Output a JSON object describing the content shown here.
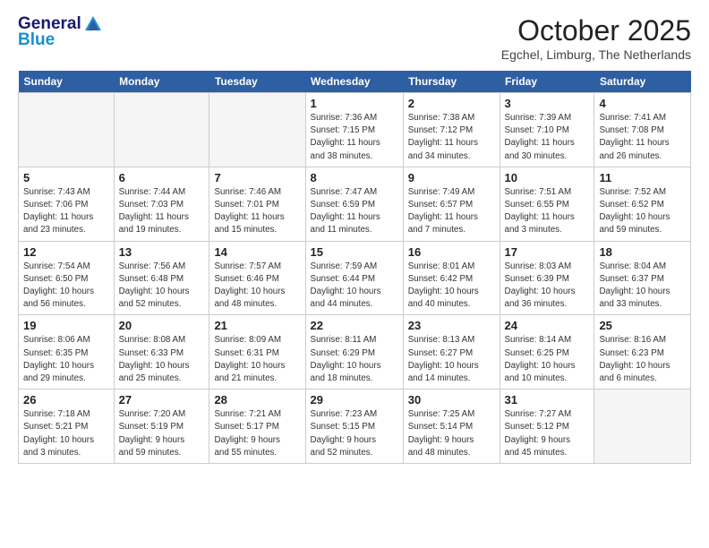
{
  "header": {
    "logo_line1": "General",
    "logo_line2": "Blue",
    "month": "October 2025",
    "location": "Egchel, Limburg, The Netherlands"
  },
  "weekdays": [
    "Sunday",
    "Monday",
    "Tuesday",
    "Wednesday",
    "Thursday",
    "Friday",
    "Saturday"
  ],
  "weeks": [
    [
      {
        "day": "",
        "info": ""
      },
      {
        "day": "",
        "info": ""
      },
      {
        "day": "",
        "info": ""
      },
      {
        "day": "1",
        "info": "Sunrise: 7:36 AM\nSunset: 7:15 PM\nDaylight: 11 hours\nand 38 minutes."
      },
      {
        "day": "2",
        "info": "Sunrise: 7:38 AM\nSunset: 7:12 PM\nDaylight: 11 hours\nand 34 minutes."
      },
      {
        "day": "3",
        "info": "Sunrise: 7:39 AM\nSunset: 7:10 PM\nDaylight: 11 hours\nand 30 minutes."
      },
      {
        "day": "4",
        "info": "Sunrise: 7:41 AM\nSunset: 7:08 PM\nDaylight: 11 hours\nand 26 minutes."
      }
    ],
    [
      {
        "day": "5",
        "info": "Sunrise: 7:43 AM\nSunset: 7:06 PM\nDaylight: 11 hours\nand 23 minutes."
      },
      {
        "day": "6",
        "info": "Sunrise: 7:44 AM\nSunset: 7:03 PM\nDaylight: 11 hours\nand 19 minutes."
      },
      {
        "day": "7",
        "info": "Sunrise: 7:46 AM\nSunset: 7:01 PM\nDaylight: 11 hours\nand 15 minutes."
      },
      {
        "day": "8",
        "info": "Sunrise: 7:47 AM\nSunset: 6:59 PM\nDaylight: 11 hours\nand 11 minutes."
      },
      {
        "day": "9",
        "info": "Sunrise: 7:49 AM\nSunset: 6:57 PM\nDaylight: 11 hours\nand 7 minutes."
      },
      {
        "day": "10",
        "info": "Sunrise: 7:51 AM\nSunset: 6:55 PM\nDaylight: 11 hours\nand 3 minutes."
      },
      {
        "day": "11",
        "info": "Sunrise: 7:52 AM\nSunset: 6:52 PM\nDaylight: 10 hours\nand 59 minutes."
      }
    ],
    [
      {
        "day": "12",
        "info": "Sunrise: 7:54 AM\nSunset: 6:50 PM\nDaylight: 10 hours\nand 56 minutes."
      },
      {
        "day": "13",
        "info": "Sunrise: 7:56 AM\nSunset: 6:48 PM\nDaylight: 10 hours\nand 52 minutes."
      },
      {
        "day": "14",
        "info": "Sunrise: 7:57 AM\nSunset: 6:46 PM\nDaylight: 10 hours\nand 48 minutes."
      },
      {
        "day": "15",
        "info": "Sunrise: 7:59 AM\nSunset: 6:44 PM\nDaylight: 10 hours\nand 44 minutes."
      },
      {
        "day": "16",
        "info": "Sunrise: 8:01 AM\nSunset: 6:42 PM\nDaylight: 10 hours\nand 40 minutes."
      },
      {
        "day": "17",
        "info": "Sunrise: 8:03 AM\nSunset: 6:39 PM\nDaylight: 10 hours\nand 36 minutes."
      },
      {
        "day": "18",
        "info": "Sunrise: 8:04 AM\nSunset: 6:37 PM\nDaylight: 10 hours\nand 33 minutes."
      }
    ],
    [
      {
        "day": "19",
        "info": "Sunrise: 8:06 AM\nSunset: 6:35 PM\nDaylight: 10 hours\nand 29 minutes."
      },
      {
        "day": "20",
        "info": "Sunrise: 8:08 AM\nSunset: 6:33 PM\nDaylight: 10 hours\nand 25 minutes."
      },
      {
        "day": "21",
        "info": "Sunrise: 8:09 AM\nSunset: 6:31 PM\nDaylight: 10 hours\nand 21 minutes."
      },
      {
        "day": "22",
        "info": "Sunrise: 8:11 AM\nSunset: 6:29 PM\nDaylight: 10 hours\nand 18 minutes."
      },
      {
        "day": "23",
        "info": "Sunrise: 8:13 AM\nSunset: 6:27 PM\nDaylight: 10 hours\nand 14 minutes."
      },
      {
        "day": "24",
        "info": "Sunrise: 8:14 AM\nSunset: 6:25 PM\nDaylight: 10 hours\nand 10 minutes."
      },
      {
        "day": "25",
        "info": "Sunrise: 8:16 AM\nSunset: 6:23 PM\nDaylight: 10 hours\nand 6 minutes."
      }
    ],
    [
      {
        "day": "26",
        "info": "Sunrise: 7:18 AM\nSunset: 5:21 PM\nDaylight: 10 hours\nand 3 minutes."
      },
      {
        "day": "27",
        "info": "Sunrise: 7:20 AM\nSunset: 5:19 PM\nDaylight: 9 hours\nand 59 minutes."
      },
      {
        "day": "28",
        "info": "Sunrise: 7:21 AM\nSunset: 5:17 PM\nDaylight: 9 hours\nand 55 minutes."
      },
      {
        "day": "29",
        "info": "Sunrise: 7:23 AM\nSunset: 5:15 PM\nDaylight: 9 hours\nand 52 minutes."
      },
      {
        "day": "30",
        "info": "Sunrise: 7:25 AM\nSunset: 5:14 PM\nDaylight: 9 hours\nand 48 minutes."
      },
      {
        "day": "31",
        "info": "Sunrise: 7:27 AM\nSunset: 5:12 PM\nDaylight: 9 hours\nand 45 minutes."
      },
      {
        "day": "",
        "info": ""
      }
    ]
  ]
}
